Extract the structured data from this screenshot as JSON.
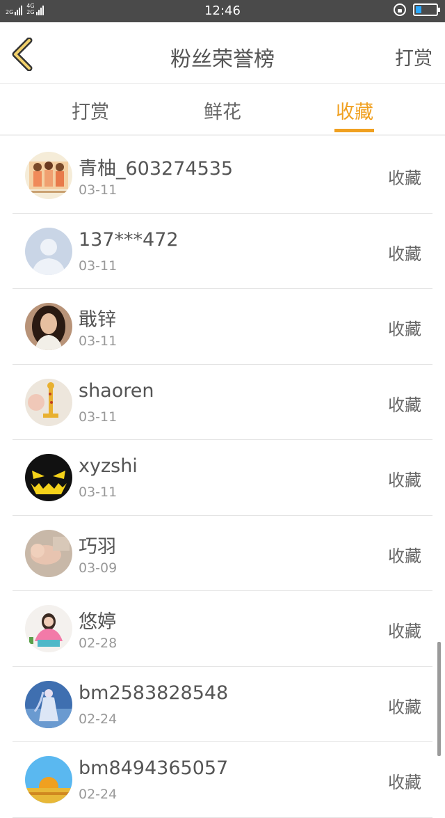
{
  "status_bar": {
    "sim1_tag": "2G",
    "sim2_tag_top": "4G",
    "sim2_tag_bottom": "2G",
    "time": "12:46",
    "battery_level": 0.3,
    "battery_color": "#2aa8ff"
  },
  "header": {
    "title": "粉丝荣誉榜",
    "right_action": "打赏"
  },
  "tabs": [
    {
      "label": "打赏",
      "active": false
    },
    {
      "label": "鲜花",
      "active": false
    },
    {
      "label": "收藏",
      "active": true
    }
  ],
  "accent_color": "#f0a020",
  "fans": [
    {
      "name": "青柚_603274535",
      "date": "03-11",
      "action": "收藏",
      "avatar": "group-photo-avatar"
    },
    {
      "name": "137***472",
      "date": "03-11",
      "action": "收藏",
      "avatar": "default-person-avatar"
    },
    {
      "name": "戢锌",
      "date": "03-11",
      "action": "收藏",
      "avatar": "woman-portrait-avatar"
    },
    {
      "name": "shaoren",
      "date": "03-11",
      "action": "收藏",
      "avatar": "giraffe-toy-avatar"
    },
    {
      "name": "xyzshi",
      "date": "03-11",
      "action": "收藏",
      "avatar": "pumpkin-face-avatar"
    },
    {
      "name": "巧羽",
      "date": "03-09",
      "action": "收藏",
      "avatar": "baby-photo-avatar"
    },
    {
      "name": "悠婷",
      "date": "02-28",
      "action": "收藏",
      "avatar": "girl-pink-avatar"
    },
    {
      "name": "bm2583828548",
      "date": "02-24",
      "action": "收藏",
      "avatar": "anime-girl-avatar"
    },
    {
      "name": "bm8494365057",
      "date": "02-24",
      "action": "收藏",
      "avatar": "sunset-avatar"
    }
  ]
}
